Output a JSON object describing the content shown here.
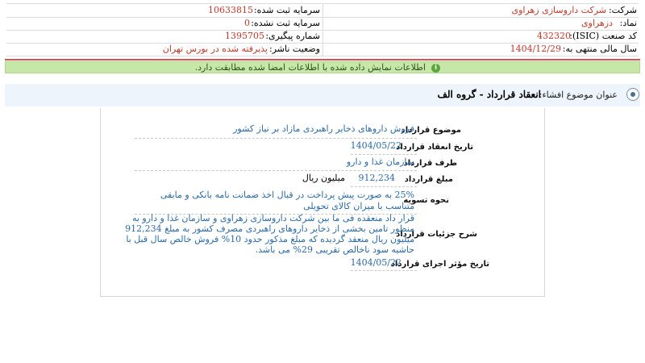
{
  "company_info": {
    "company_label": "شرکت:",
    "company_value": "شرکت داروسازی زهراوی",
    "symbol_label": "نماد:",
    "symbol_value": "دزهراوی",
    "isic_label": "کد صنعت (ISIC):",
    "isic_value": "432320",
    "fiscal_label": "سال مالی منتهی به:",
    "fiscal_value": "1404/12/29",
    "capital_registered_label": "سرمایه ثبت شده:",
    "capital_registered_value": "10633815",
    "capital_unregistered_label": "سرمایه ثبت نشده:",
    "capital_unregistered_value": "0",
    "tracking_label": "شماره پیگیری:",
    "tracking_value": "1395705",
    "publisher_status_label": "وضعیت ناشر:",
    "publisher_status_value": "پذیرفته شده در بورس تهران"
  },
  "notice": {
    "text": "اطلاعات نمایش داده شده با اطلاعات امضا شده مطابقت دارد."
  },
  "subject": {
    "label": "عنوان موضوع افشاء:",
    "title": "انعقاد قرارداد - گروه الف"
  },
  "contract": {
    "subject_label": "موضوع قرارداد",
    "subject_value": "فروش داروهای ذخایر راهبردی مازاد بر نیاز کشور",
    "date_label": "تاریخ انعقاد قرارداد",
    "date_value": "1404/05/22",
    "party_label": "طرف قرارداد",
    "party_value": "سازمان غذا و دارو",
    "amount_label": "مبلغ قرارداد",
    "amount_value": "912,234",
    "amount_unit": "میلیون ریال",
    "settlement_label": "نحوه تسویه",
    "settlement_value": "25% به صورت پیش پرداخت در قبال اخذ ضمانت نامه بانکی و مابقی متناسب با میزان کالای تحویلی",
    "details_label": "شرح جزئیات قرارداد",
    "details_value": "قرار داد منعقده فی ما بین شرکت داروسازی زهراوی و سازمان غذا و دارو به منظور تامین بخشی از ذخایر داروهای راهبردی مصرف کشور به مبلغ 912,234 میلیون ریال منعقد گردیده که مبلغ مذکور حدود 10% فروش خالص سال قبل با حاشیه سود ناخالص تقریبی 29% می باشد.",
    "effective_label": "تاریخ مؤثر اجرای قرارداد",
    "effective_value": "1404/05/22"
  },
  "colors": {
    "value_red": "#c0392b",
    "value_blue": "#2b6aa6",
    "notice_green": "#c6e7a8",
    "divider_red": "#d9534f",
    "subject_bg": "#eef4fb"
  }
}
